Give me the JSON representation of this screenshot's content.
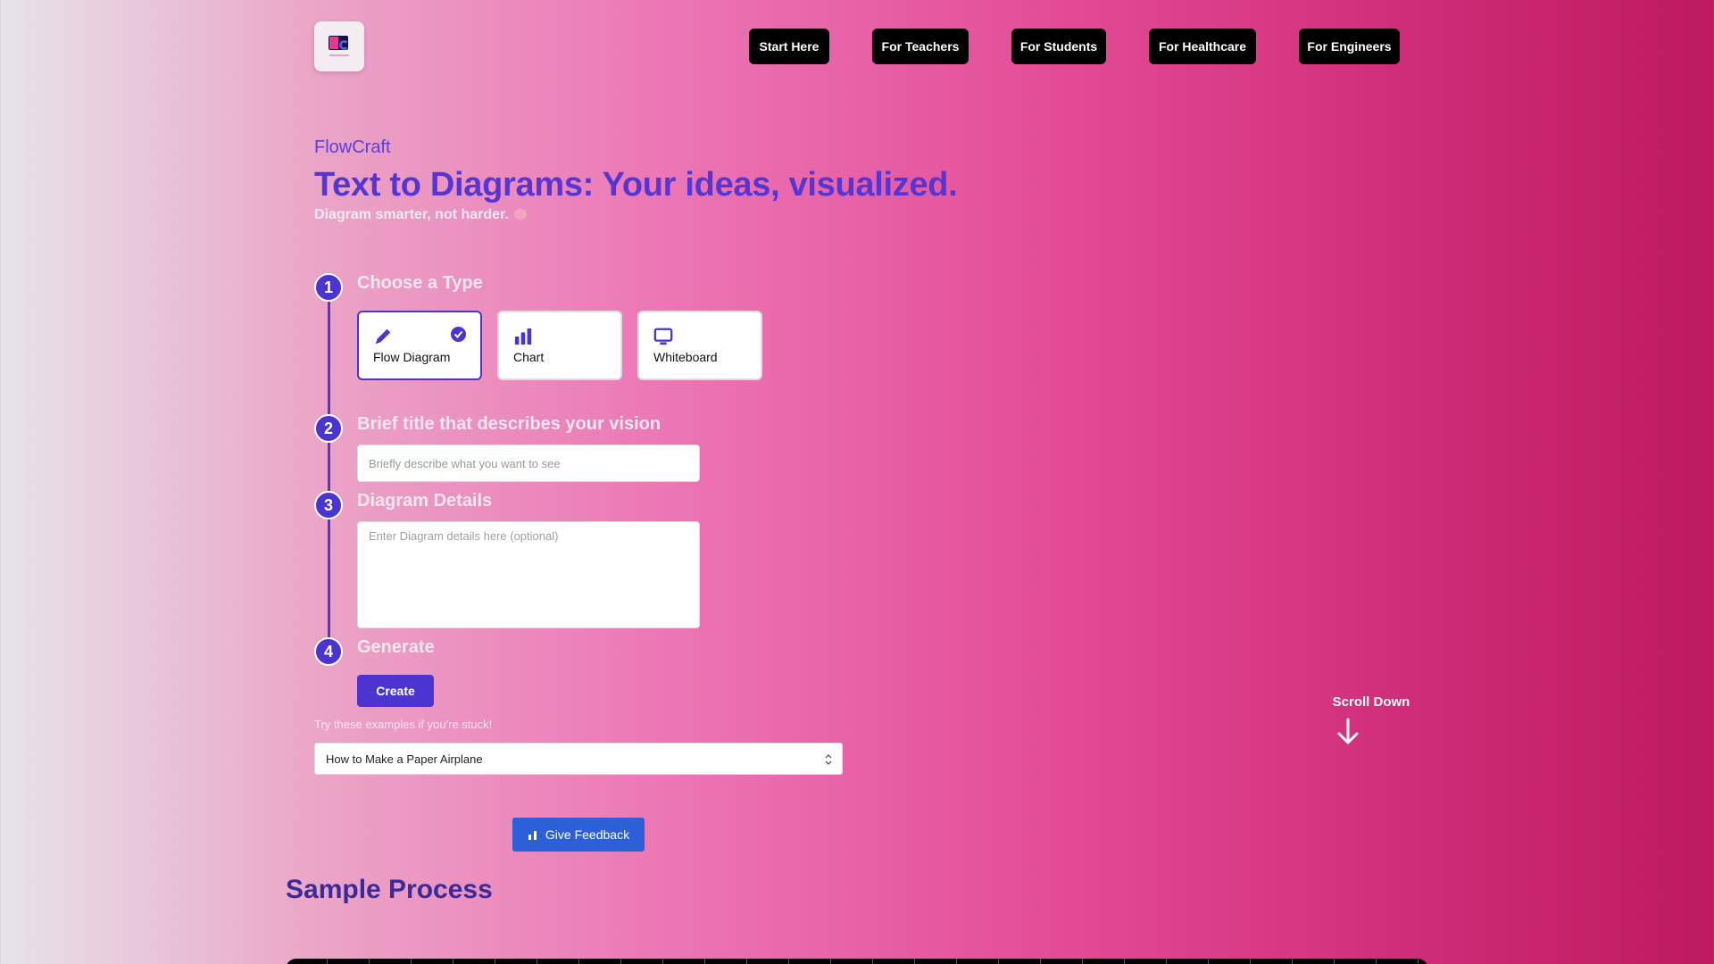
{
  "nav": {
    "items": [
      "Start Here",
      "For Teachers",
      "For Students",
      "For Healthcare",
      "For Engineers"
    ]
  },
  "hero": {
    "brand": "FlowCraft",
    "headline": "Text to Diagrams: Your ideas, visualized.",
    "tagline": "Diagram smarter, not harder."
  },
  "steps": {
    "step1": {
      "number": "1",
      "title": "Choose a Type"
    },
    "step2": {
      "number": "2",
      "title": "Brief title that describes your vision"
    },
    "step3": {
      "number": "3",
      "title": "Diagram Details"
    },
    "step4": {
      "number": "4",
      "title": "Generate"
    }
  },
  "types": [
    {
      "label": "Flow Diagram",
      "icon": "pencil-icon",
      "selected": true
    },
    {
      "label": "Chart",
      "icon": "bar-chart-icon",
      "selected": false
    },
    {
      "label": "Whiteboard",
      "icon": "monitor-icon",
      "selected": false
    }
  ],
  "form": {
    "title_placeholder": "Briefly describe what you want to see",
    "title_value": "",
    "details_placeholder": "Enter Diagram details here (optional)",
    "details_value": "",
    "create_label": "Create"
  },
  "examples": {
    "label": "Try these examples if you're stuck!",
    "selected": "How to Make a Paper Airplane"
  },
  "feedback": {
    "label": "Give Feedback"
  },
  "scroll": {
    "label": "Scroll Down"
  },
  "sample": {
    "title": "Sample Process"
  },
  "colors": {
    "accent": "#4b34cf",
    "feedback": "#2d5fd8",
    "nav_bg": "#000000"
  }
}
